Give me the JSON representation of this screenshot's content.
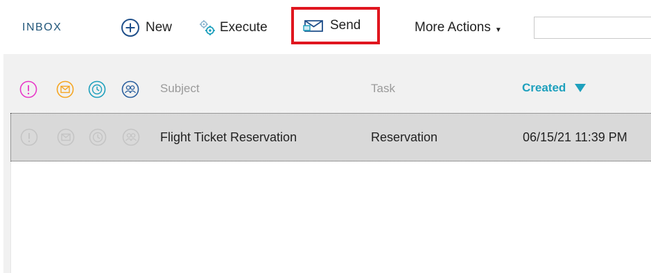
{
  "toolbar": {
    "title": "INBOX",
    "new_label": "New",
    "execute_label": "Execute",
    "send_label": "Send",
    "more_actions_label": "More Actions",
    "search_value": "",
    "highlight_color": "#e0161f"
  },
  "grid": {
    "header": {
      "subject": "Subject",
      "task": "Task",
      "created": "Created",
      "sort_direction": "descending"
    },
    "rows": [
      {
        "subject": "Flight Ticket Reservation",
        "task": "Reservation",
        "created": "06/15/21 11:39 PM",
        "selected": true
      }
    ]
  },
  "colors": {
    "priority": "#e838c8",
    "message": "#f5a623",
    "time": "#1ea0bd",
    "group": "#2a5f9e",
    "accent": "#1ea0bd"
  }
}
